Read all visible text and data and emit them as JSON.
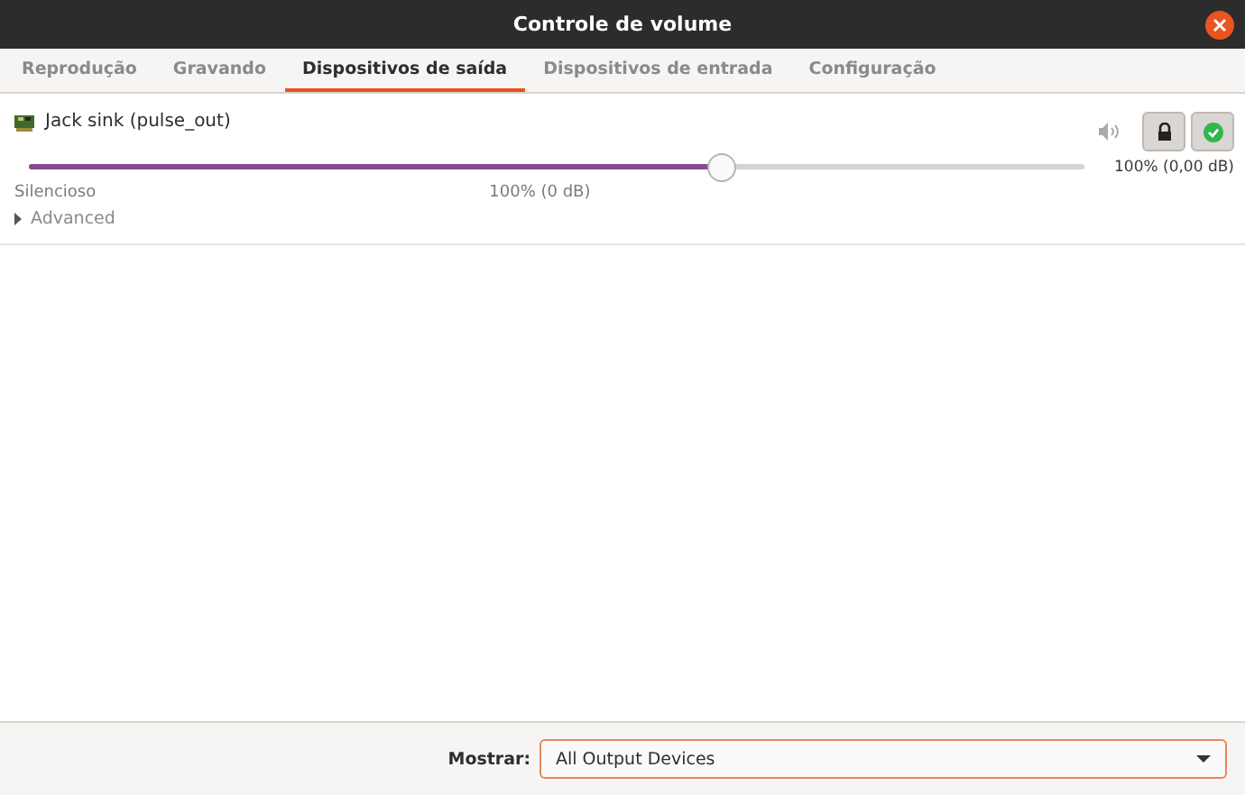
{
  "window": {
    "title": "Controle de volume"
  },
  "tabs": [
    {
      "label": "Reprodução",
      "selected": false
    },
    {
      "label": "Gravando",
      "selected": false
    },
    {
      "label": "Dispositivos de saída",
      "selected": true
    },
    {
      "label": "Dispositivos de entrada",
      "selected": false
    },
    {
      "label": "Configuração",
      "selected": false
    }
  ],
  "devices": [
    {
      "name": "Jack sink (pulse_out)",
      "muted": false,
      "locked": true,
      "is_default": true,
      "level": 0.656,
      "min_label": "Silencioso",
      "mark_label": "100% (0 dB)",
      "reading": "100% (0,00 dB)",
      "advanced": {
        "label": "Advanced",
        "expanded": false
      }
    }
  ],
  "footer": {
    "label": "Mostrar:",
    "value": "All Output Devices"
  }
}
